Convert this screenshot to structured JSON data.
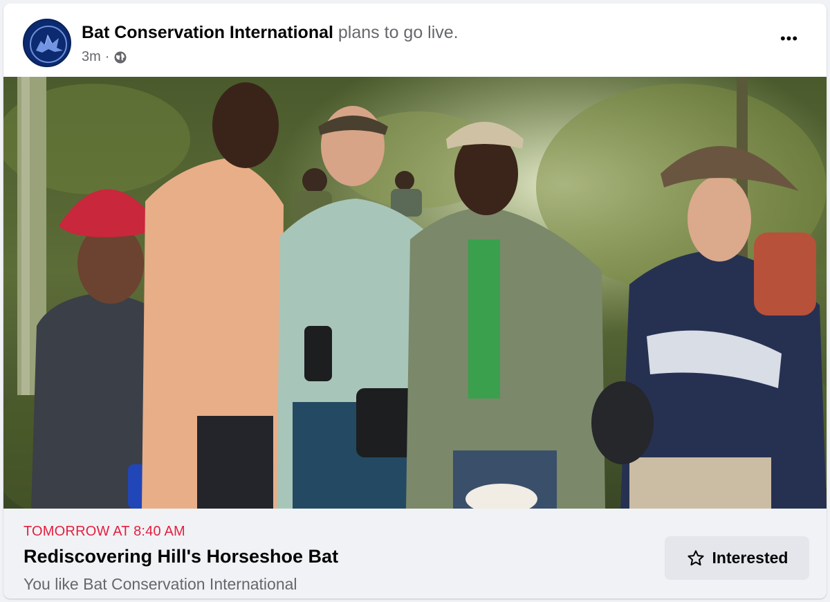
{
  "post": {
    "author": "Bat Conservation International",
    "action": "plans to go live.",
    "time": "3m",
    "separator": "·",
    "privacy_icon": "globe-icon",
    "more_icon": "more-horizontal-icon",
    "more_label": "•••"
  },
  "event": {
    "date_line": "TOMORROW AT 8:40 AM",
    "title": "Rediscovering Hill's Horseshoe Bat",
    "subtitle": "You like Bat Conservation International",
    "interested_label": "Interested",
    "interested_icon": "star-outline-icon"
  },
  "colors": {
    "accent_red": "#e41e3f",
    "secondary_text": "#65676b",
    "button_bg": "#e4e6eb",
    "avatar_blue": "#0b2a6f"
  }
}
